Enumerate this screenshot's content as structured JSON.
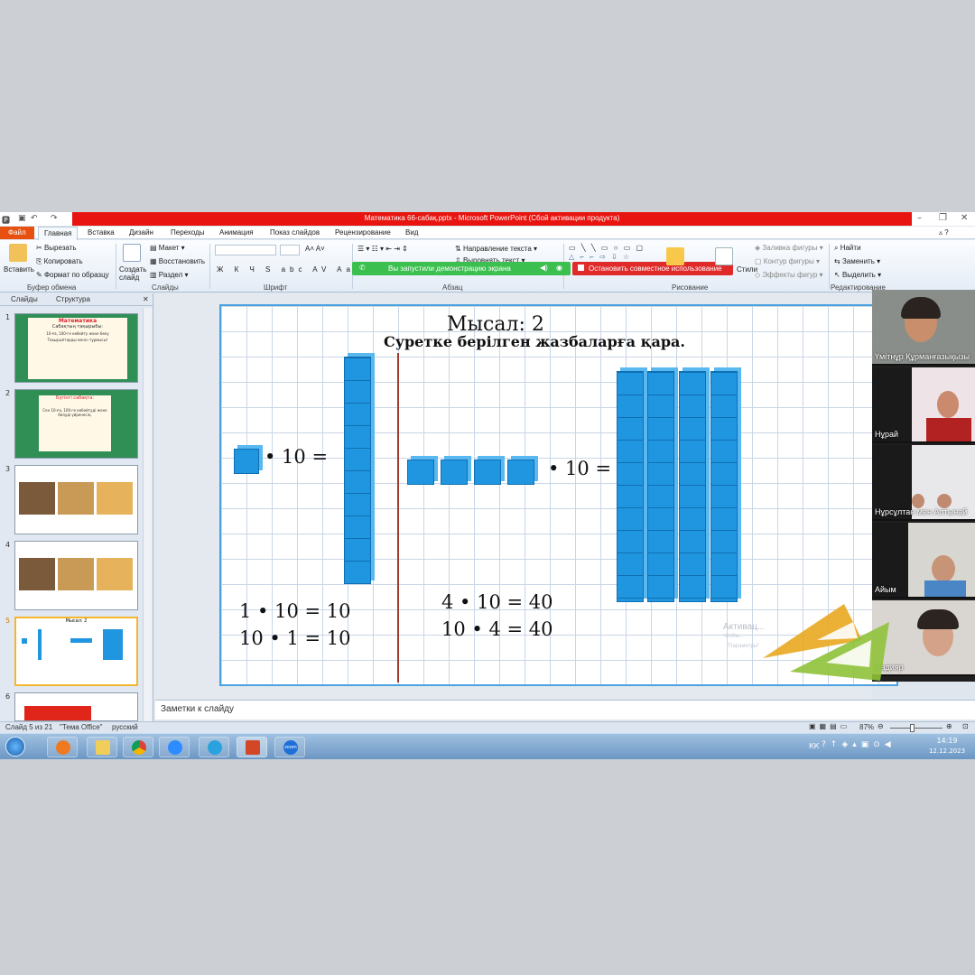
{
  "window": {
    "title": "Математика 66-сабақ.pptx - Microsoft PowerPoint (Сбой активации продукта)"
  },
  "tabs": [
    "Файл",
    "Главная",
    "Вставка",
    "Дизайн",
    "Переходы",
    "Анимация",
    "Показ слайдов",
    "Рецензирование",
    "Вид"
  ],
  "ribbon": {
    "paste": "Вставить",
    "cut": "Вырезать",
    "copy": "Копировать",
    "format_painter": "Формат по образцу",
    "clipboard_group": "Буфер обмена",
    "new_slide": "Создать слайд",
    "layout": "Макет",
    "reset": "Восстановить",
    "section": "Раздел",
    "slides_group": "Слайды",
    "font_group": "Шрифт",
    "text_direction": "Направление текста",
    "align_text": "Выровнять текст",
    "paragraph_group": "Абзац",
    "drawing_group": "Рисование",
    "shape_fill": "Заливка фигуры",
    "shape_outline": "Контур фигуры",
    "shape_effects": "Эффекты фигур",
    "styles": "Стили",
    "find": "Найти",
    "replace": "Заменить",
    "select": "Выделить",
    "editing_group": "Редактирование",
    "share_banner": "Вы запустили демонстрацию экрана",
    "stop_share": "Остановить совместное использование"
  },
  "leftpanel": {
    "tab_slides": "Слайды",
    "tab_outline": "Структура",
    "thumbnails": [
      {
        "num": "1",
        "title": "Математика",
        "subtitle": "Сабақтың тақырыбы:",
        "line": "10-ға, 100-ге көбейту және бөлу",
        "line2": "Тақырыптарды мәнін тұрмысы!"
      },
      {
        "num": "2",
        "title": "Бүгінгі сабақта:",
        "line": "Сен 10-ға, 100-ге көбейтуді және бөлуді үйренесің."
      },
      {
        "num": "3"
      },
      {
        "num": "4"
      },
      {
        "num": "5",
        "title": "Мысал: 2"
      },
      {
        "num": "6"
      }
    ]
  },
  "slide": {
    "title": "Мысал: 2",
    "subtitle": "Суретке берілген жазбаларға қара.",
    "eq_left": "• 10 =",
    "eq_right": "• 10 =",
    "left_line1": "1 • 10 = 10",
    "left_line2": "10 • 1 = 10",
    "right_line1": "4 • 10 = 40",
    "right_line2": "10 • 4 = 40",
    "watermark": "Активац...",
    "watermark2": "Чтобы...",
    "watermark3": "\"Параметры\""
  },
  "notes_placeholder": "Заметки к слайду",
  "status": {
    "slide_info": "Слайд 5 из 21",
    "theme": "\"Тема Office\"",
    "language": "русский",
    "zoom": "87%"
  },
  "taskbar": {
    "lang": "КК",
    "time": "14:19",
    "date": "12.12.2023",
    "zoom_label": "zoom"
  },
  "participants": [
    {
      "name": "Үмітнұр Құрманғазықызы"
    },
    {
      "name": "Нұрай"
    },
    {
      "name": "Нұрсұлтан мен Алтынай"
    },
    {
      "name": "Айым"
    },
    {
      "name": "Надияр"
    }
  ]
}
